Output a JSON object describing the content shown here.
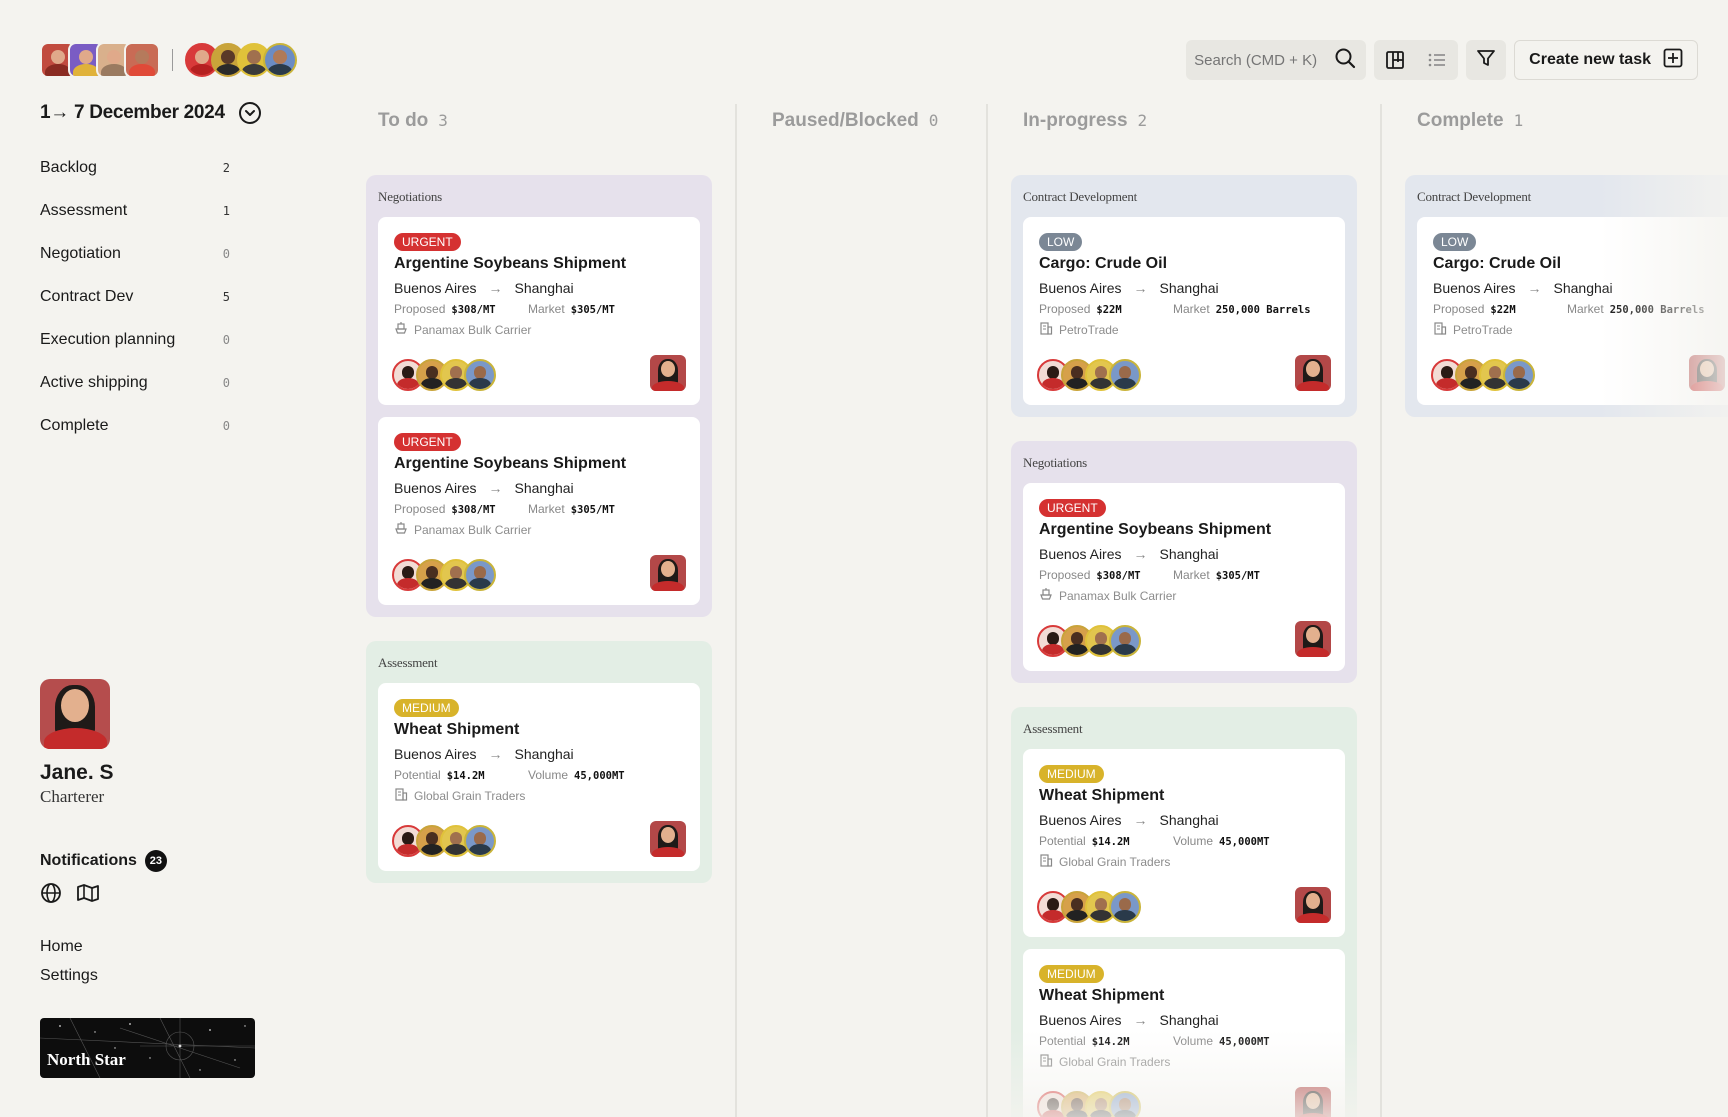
{
  "team_avatars_left": [
    "#c14b3f",
    "#7a5cc4",
    "#d9b08c",
    "#c96b55"
  ],
  "team_avatars_right": [
    "#d83a3a",
    "#c9a43a",
    "#e0c23a",
    "#6b8cc4"
  ],
  "date_range": "1→ 7 December 2024",
  "stages": [
    {
      "label": "Backlog",
      "count": "2"
    },
    {
      "label": "Assessment",
      "count": "1"
    },
    {
      "label": "Negotiation",
      "count": "0"
    },
    {
      "label": "Contract Dev",
      "count": "5"
    },
    {
      "label": "Execution planning",
      "count": "0"
    },
    {
      "label": "Active shipping",
      "count": "0"
    },
    {
      "label": "Complete",
      "count": "0"
    }
  ],
  "profile": {
    "name": "Jane. S",
    "role": "Charterer"
  },
  "notifications": {
    "label": "Notifications",
    "count": "23"
  },
  "bottom_links": {
    "home": "Home",
    "settings": "Settings"
  },
  "brand": "North Star",
  "toolbar": {
    "search_placeholder": "Search (CMD + K)",
    "create_label": "Create new task"
  },
  "columns": {
    "todo": {
      "title": "To do",
      "count": "3"
    },
    "paused": {
      "title": "Paused/Blocked",
      "count": "0"
    },
    "inprogress": {
      "title": "In-progress",
      "count": "2"
    },
    "complete": {
      "title": "Complete",
      "count": "1"
    }
  },
  "groups": {
    "negotiations": "Negotiations",
    "assessment": "Assessment",
    "contract_dev": "Contract Development"
  },
  "cards": {
    "soy": {
      "priority": "URGENT",
      "title": "Argentine Soybeans Shipment",
      "from": "Buenos Aires",
      "to": "Shanghai",
      "m1_label": "Proposed",
      "m1_value": "$308/MT",
      "m2_label": "Market",
      "m2_value": "$305/MT",
      "vessel": "Panamax Bulk Carrier"
    },
    "wheat": {
      "priority": "MEDIUM",
      "title": "Wheat Shipment",
      "from": "Buenos Aires",
      "to": "Shanghai",
      "m1_label": "Potential",
      "m1_value": "$14.2M",
      "m2_label": "Volume",
      "m2_value": "45,000MT",
      "vessel": "Global Grain Traders"
    },
    "oil": {
      "priority": "LOW",
      "title": "Cargo: Crude Oil",
      "from": "Buenos Aires",
      "to": "Shanghai",
      "m1_label": "Proposed",
      "m1_value": "$22M",
      "m2_label": "Market",
      "m2_value": "250,000 Barrels",
      "vessel": "PetroTrade"
    }
  },
  "colors": {
    "urgent": "#d53131",
    "medium": "#d8b32a",
    "low": "#7b8795",
    "negotiations_bg": "#e6e1ec",
    "assessment_bg": "#e3eee5",
    "contract_bg": "#e3e7ee"
  }
}
